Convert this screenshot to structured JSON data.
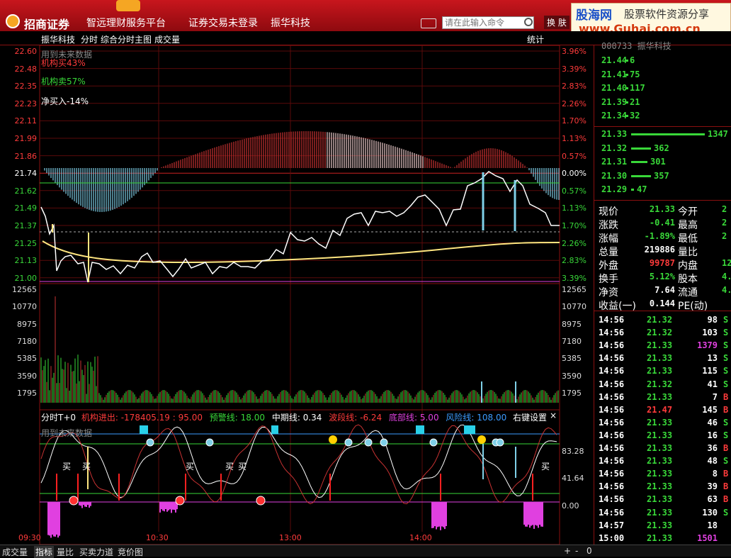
{
  "header": {
    "brand": "招商证券",
    "platform": "智远理财服务平台",
    "login": "证券交易未登录",
    "stock": "振华科技",
    "search_placeholder": "请在此输入命令",
    "switch": "换 肤",
    "site_name": "股海网",
    "site_slogan": "股票软件资源分享",
    "site_url": "www.Guhai.com.cn"
  },
  "subbar": {
    "stock": "振华科技",
    "mode": "分时",
    "chart": "综合分时主图",
    "vol": "成交量",
    "stats": "统计"
  },
  "price_axis": {
    "left": [
      "22.60",
      "22.48",
      "22.35",
      "22.23",
      "22.11",
      "21.99",
      "21.86",
      "21.74",
      "21.62",
      "21.49",
      "21.37",
      "21.25",
      "21.13",
      "21.00"
    ],
    "right": [
      "3.96%",
      "3.39%",
      "2.83%",
      "2.26%",
      "1.70%",
      "1.13%",
      "0.57%",
      "0.00%",
      "0.57%",
      "1.13%",
      "1.70%",
      "2.26%",
      "2.83%",
      "3.39%"
    ]
  },
  "vol_axis": [
    "12565",
    "10770",
    "8975",
    "7180",
    "5385",
    "3590",
    "1795"
  ],
  "main_labels": {
    "future": "用到未来数据",
    "inst_buy": "机构买43%",
    "inst_sell": "机构卖57%",
    "net_buy": "净买入-14%"
  },
  "indicator": {
    "name": "分时T+0",
    "jg": "机构进出: -178405.19 : 95.00",
    "warn": "预警线: 18.00",
    "mid": "中期线: 0.34",
    "wave": "波段线: -6.24",
    "bottom": "底部线: 5.00",
    "risk": "风险线: 108.00",
    "settings": "右键设置",
    "close": "×",
    "future": "用到未来数据",
    "axis": [
      "83.28",
      "41.64",
      "0.00"
    ],
    "buy_label": "买"
  },
  "time_axis": [
    "09:30",
    "10:30",
    "13:00",
    "14:00"
  ],
  "order_book": {
    "top_title": "000733 振华科技",
    "asks": [
      [
        "21.44",
        "6"
      ],
      [
        "21.41",
        "75"
      ],
      [
        "21.40",
        "117"
      ],
      [
        "21.39",
        "21"
      ],
      [
        "21.34",
        "32"
      ]
    ],
    "bids": [
      [
        "21.33",
        "1347"
      ],
      [
        "21.32",
        "362"
      ],
      [
        "21.31",
        "301"
      ],
      [
        "21.30",
        "357"
      ],
      [
        "21.29",
        "47"
      ]
    ]
  },
  "stats": [
    [
      "现价",
      "21.33",
      "今开",
      "2"
    ],
    [
      "涨跌",
      "-0.41",
      "最高",
      "2"
    ],
    [
      "涨幅",
      "-1.89%",
      "最低",
      "2"
    ],
    [
      "总量",
      "219886",
      "量比",
      ""
    ],
    [
      "外盘",
      "99787",
      "内盘",
      "12"
    ],
    [
      "换手",
      "5.12%",
      "股本",
      "4."
    ],
    [
      "净资",
      "7.64",
      "流通",
      "4."
    ],
    [
      "收益(一)",
      "0.144",
      "PE(动)",
      ""
    ]
  ],
  "ticks": [
    [
      "14:56",
      "21.32",
      "98",
      "S"
    ],
    [
      "14:56",
      "21.32",
      "103",
      "S"
    ],
    [
      "14:56",
      "21.33",
      "1379",
      "S"
    ],
    [
      "14:56",
      "21.33",
      "13",
      "S"
    ],
    [
      "14:56",
      "21.33",
      "115",
      "S"
    ],
    [
      "14:56",
      "21.32",
      "41",
      "S"
    ],
    [
      "14:56",
      "21.33",
      "7",
      "B"
    ],
    [
      "14:56",
      "21.47",
      "145",
      "B"
    ],
    [
      "14:56",
      "21.33",
      "46",
      "S"
    ],
    [
      "14:56",
      "21.33",
      "16",
      "S"
    ],
    [
      "14:56",
      "21.33",
      "36",
      "B"
    ],
    [
      "14:56",
      "21.33",
      "48",
      "S"
    ],
    [
      "14:56",
      "21.33",
      "8",
      "B"
    ],
    [
      "14:56",
      "21.33",
      "39",
      "B"
    ],
    [
      "14:56",
      "21.33",
      "63",
      "B"
    ],
    [
      "14:56",
      "21.33",
      "130",
      "S"
    ],
    [
      "14:57",
      "21.33",
      "18",
      ""
    ],
    [
      "15:00",
      "21.33",
      "1501",
      ""
    ]
  ],
  "bottom_tabs": [
    "成交量",
    "指标",
    "量比",
    "买卖力道",
    "竞价图"
  ],
  "bottom_right": [
    "+",
    "-",
    "0"
  ]
}
